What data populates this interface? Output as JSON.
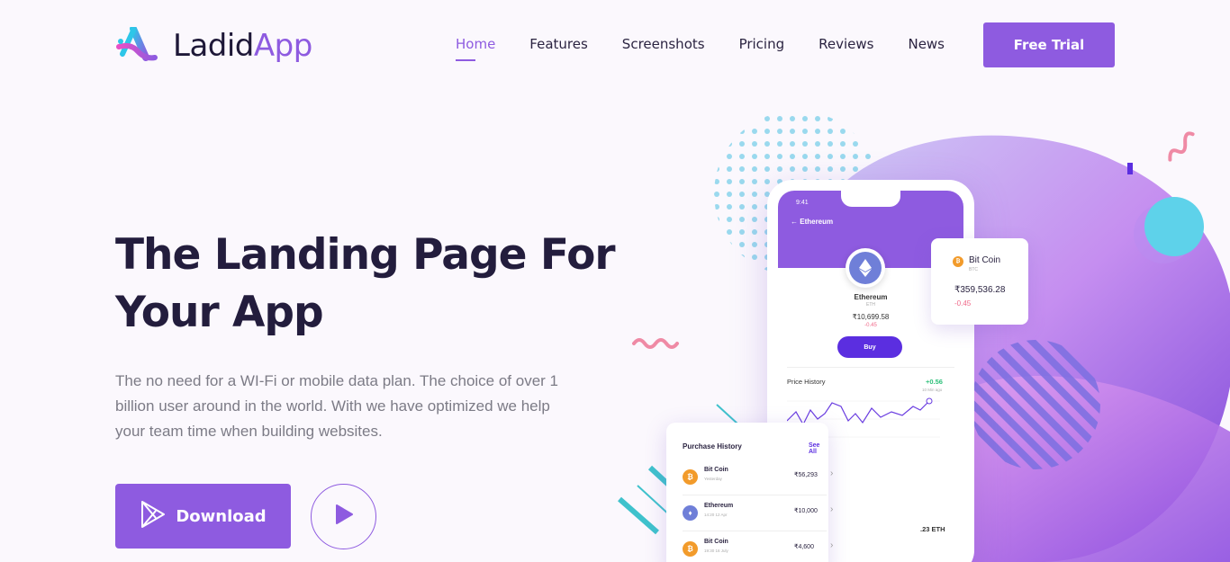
{
  "brand": {
    "name_prefix": "Ladid",
    "name_suffix": "App"
  },
  "nav": {
    "items": [
      "Home",
      "Features",
      "Screenshots",
      "Pricing",
      "Reviews",
      "News"
    ],
    "active": "Home"
  },
  "header": {
    "cta_label": "Free Trial"
  },
  "hero": {
    "title_line1": "The Landing Page For",
    "title_line2": "Your App",
    "description": "The no need for a WI-Fi or mobile data plan. The choice of over 1 billion user around in the world. With we have optimized we help your team time when building websites.",
    "download_label": "Download"
  },
  "phone": {
    "time": "9:41",
    "header": "Ethereum",
    "coin_name": "Ethereum",
    "coin_symbol": "ETH",
    "price": "₹10,699.58",
    "change": "-0.45",
    "buy_label": "Buy",
    "price_history_label": "Price History",
    "price_history_change": "+0.56",
    "price_history_time": "10 Min ago",
    "eth_amount": ".23 ETH"
  },
  "btc_card": {
    "name": "Bit Coin",
    "symbol": "BTC",
    "price": "₹359,536.28",
    "change": "-0.45"
  },
  "purchase_history": {
    "title": "Purchase History",
    "see_all": "See All",
    "rows": [
      {
        "name": "Bit Coin",
        "sub": "Yesterday",
        "amount": "₹56,293",
        "coin": "btc"
      },
      {
        "name": "Ethereum",
        "sub": "14:20 12 Apr",
        "amount": "₹10,000",
        "coin": "eth"
      },
      {
        "name": "Bit Coin",
        "sub": "19:30 16 July",
        "amount": "₹4,600",
        "coin": "btc"
      }
    ]
  },
  "colors": {
    "accent": "#8e5be0",
    "dark": "#231d3d",
    "text_muted": "#7c7b86"
  }
}
